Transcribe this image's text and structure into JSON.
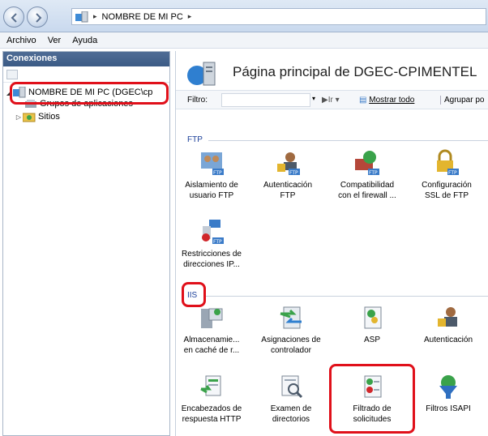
{
  "address": {
    "breadcrumb": "NOMBRE DE MI PC",
    "separator": "▸"
  },
  "menu": {
    "items": [
      "Archivo",
      "Ver",
      "Ayuda"
    ]
  },
  "connections": {
    "title": "Conexiones",
    "tree": [
      {
        "label": "NOMBRE DE MI PC (DGEC\\cp",
        "expanded": true
      },
      {
        "label": "Grupos de aplicaciones"
      },
      {
        "label": "Sitios"
      }
    ]
  },
  "main": {
    "title": "Página principal de DGEC-CPIMENTEL",
    "filter": {
      "label": "Filtro:",
      "go": "Ir",
      "show_all": "Mostrar todo",
      "group_by": "Agrupar po"
    },
    "groups": {
      "ftp": {
        "label": "FTP",
        "tiles": [
          {
            "line1": "Aislamiento de",
            "line2": "usuario FTP"
          },
          {
            "line1": "Autenticación",
            "line2": "FTP"
          },
          {
            "line1": "Compatibilidad",
            "line2": "con el firewall ..."
          },
          {
            "line1": "Configuración",
            "line2": "SSL de FTP"
          },
          {
            "line1": "Restricciones de",
            "line2": "direcciones IP..."
          }
        ]
      },
      "iis": {
        "label": "IIS",
        "tiles": [
          {
            "line1": "Almacenamie...",
            "line2": "en caché de r..."
          },
          {
            "line1": "Asignaciones de",
            "line2": "controlador"
          },
          {
            "line1": "ASP",
            "line2": ""
          },
          {
            "line1": "Autenticación",
            "line2": ""
          },
          {
            "line1": "Encabezados de",
            "line2": "respuesta HTTP"
          },
          {
            "line1": "Examen de",
            "line2": "directorios"
          },
          {
            "line1": "Filtrado de",
            "line2": "solicitudes"
          },
          {
            "line1": "Filtros ISAPI",
            "line2": ""
          }
        ]
      }
    }
  },
  "colors": {
    "highlight": "#e0101a",
    "group_label": "#1a3e99",
    "header": "#3b5b85"
  }
}
